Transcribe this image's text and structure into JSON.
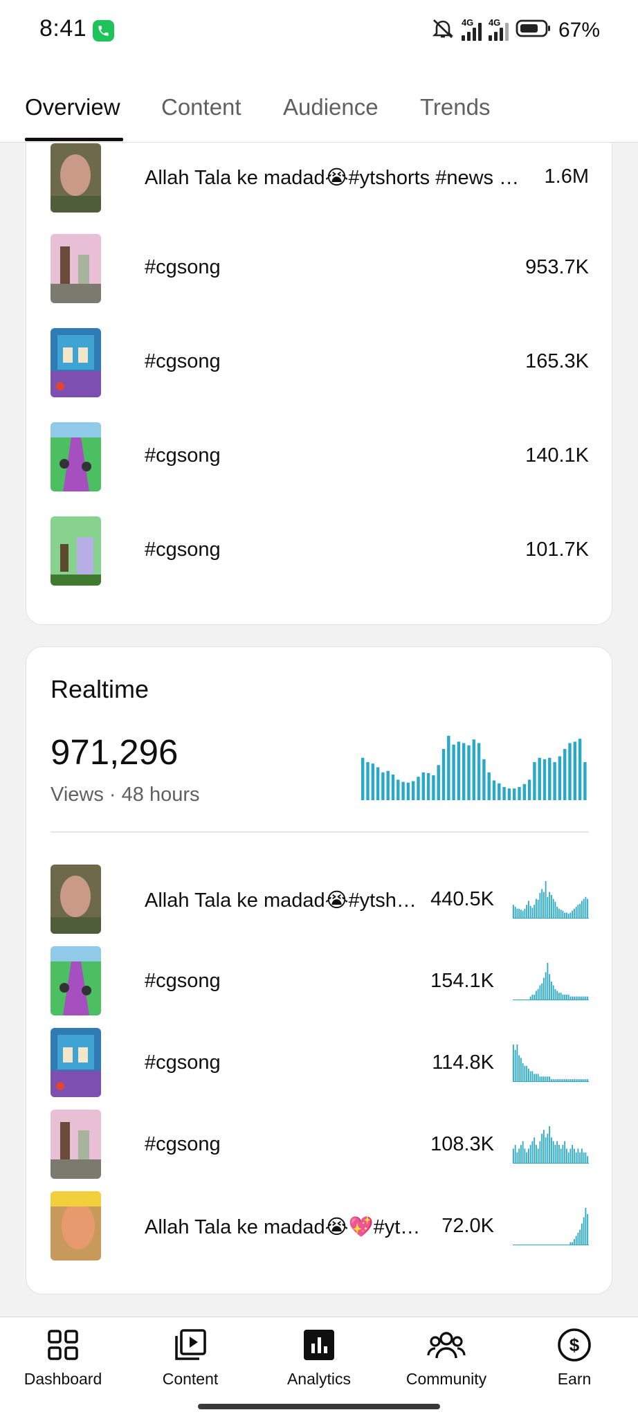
{
  "status_bar": {
    "time": "8:41",
    "battery_pct": "67%"
  },
  "tabs": [
    {
      "label": "Overview",
      "active": true
    },
    {
      "label": "Content",
      "active": false
    },
    {
      "label": "Audience",
      "active": false
    },
    {
      "label": "Trends",
      "active": false
    }
  ],
  "top_content": {
    "rows": [
      {
        "title": "Allah Tala ke madad😭#ytshorts #news …",
        "value": "1.6M"
      },
      {
        "title": "#cgsong",
        "value": "953.7K"
      },
      {
        "title": "#cgsong",
        "value": "165.3K"
      },
      {
        "title": "#cgsong",
        "value": "140.1K"
      },
      {
        "title": "#cgsong",
        "value": "101.7K"
      }
    ]
  },
  "realtime": {
    "title": "Realtime",
    "total_views": "971,296",
    "views_label": "Views",
    "separator": "·",
    "period": "48 hours",
    "chart_data": {
      "type": "bar",
      "values": [
        58,
        52,
        50,
        45,
        38,
        40,
        35,
        28,
        25,
        24,
        26,
        32,
        38,
        37,
        34,
        48,
        70,
        88,
        76,
        80,
        78,
        75,
        83,
        78,
        56,
        38,
        27,
        23,
        18,
        16,
        16,
        18,
        22,
        28,
        52,
        58,
        56,
        58,
        52,
        60,
        70,
        78,
        80,
        84,
        52
      ]
    },
    "rows": [
      {
        "title": "Allah Tala ke madad😭#ytsh…",
        "value": "440.5K",
        "spark": [
          14,
          12,
          10,
          10,
          9,
          8,
          10,
          14,
          18,
          13,
          11,
          14,
          20,
          19,
          26,
          30,
          27,
          38,
          22,
          27,
          24,
          20,
          17,
          12,
          10,
          9,
          8,
          6,
          6,
          5,
          6,
          8,
          10,
          12,
          14,
          15,
          18,
          20,
          22,
          20
        ]
      },
      {
        "title": "#cgsong",
        "value": "154.1K",
        "spark": [
          0,
          0,
          0,
          0,
          0,
          0,
          0,
          0,
          0,
          2,
          3,
          3,
          5,
          6,
          8,
          9,
          12,
          15,
          20,
          14,
          10,
          8,
          6,
          5,
          4,
          4,
          3,
          3,
          3,
          3,
          2,
          2,
          2,
          2,
          2,
          2,
          2,
          2,
          2,
          2
        ]
      },
      {
        "title": "#cgsong",
        "value": "114.8K",
        "spark": [
          14,
          12,
          14,
          10,
          9,
          7,
          6,
          6,
          5,
          4,
          4,
          3,
          3,
          3,
          2,
          2,
          2,
          2,
          2,
          2,
          1,
          1,
          1,
          1,
          1,
          1,
          1,
          1,
          1,
          1,
          1,
          1,
          1,
          1,
          1,
          1,
          1,
          1,
          1,
          1
        ]
      },
      {
        "title": "#cgsong",
        "value": "108.3K",
        "spark": [
          4,
          5,
          3,
          4,
          5,
          6,
          4,
          3,
          4,
          5,
          6,
          7,
          5,
          4,
          6,
          8,
          9,
          7,
          8,
          10,
          7,
          6,
          5,
          6,
          5,
          4,
          5,
          6,
          4,
          3,
          4,
          5,
          4,
          3,
          4,
          3,
          4,
          3,
          3,
          2
        ]
      },
      {
        "title": "Allah Tala ke madad😭💖#yt…",
        "value": "72.0K",
        "spark": [
          0,
          0,
          0,
          0,
          0,
          0,
          0,
          0,
          0,
          0,
          0,
          0,
          0,
          0,
          0,
          0,
          0,
          0,
          0,
          0,
          0,
          0,
          0,
          0,
          0,
          0,
          0,
          0,
          0,
          0,
          1,
          1,
          2,
          3,
          4,
          5,
          7,
          9,
          12,
          10
        ]
      }
    ]
  },
  "bottom_nav": [
    {
      "label": "Dashboard",
      "icon": "dashboard-icon"
    },
    {
      "label": "Content",
      "icon": "content-icon"
    },
    {
      "label": "Analytics",
      "icon": "analytics-icon"
    },
    {
      "label": "Community",
      "icon": "community-icon"
    },
    {
      "label": "Earn",
      "icon": "earn-icon"
    }
  ],
  "colors": {
    "accent": "#27a9c7",
    "text": "#0f0f0f",
    "secondary": "#606060"
  }
}
